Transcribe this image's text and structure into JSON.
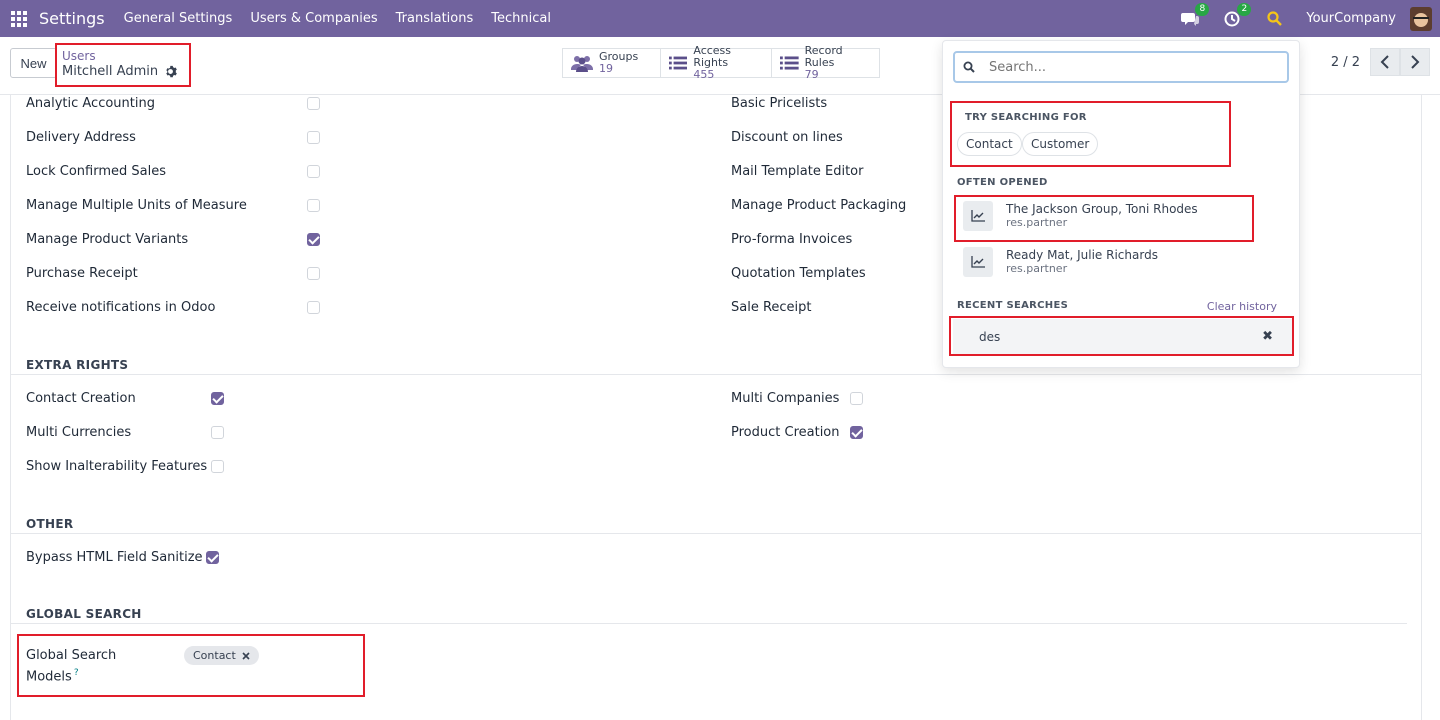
{
  "navbar": {
    "app_name": "Settings",
    "menu": [
      "General Settings",
      "Users & Companies",
      "Translations",
      "Technical"
    ],
    "messages_badge": "8",
    "activities_badge": "2",
    "company": "YourCompany",
    "accent": "#71639e"
  },
  "control": {
    "new_label": "New",
    "breadcrumb_parent": "Users",
    "breadcrumb_current": "Mitchell Admin",
    "stats": [
      {
        "label": "Groups",
        "value": "19",
        "icon": "users-icon"
      },
      {
        "label": "Access Rights",
        "value": "455",
        "icon": "list-icon"
      },
      {
        "label": "Record Rules",
        "value": "79",
        "icon": "list-icon"
      }
    ],
    "pager": "2 / 2"
  },
  "form": {
    "left_rows": [
      {
        "label": "Analytic Accounting",
        "checked": false
      },
      {
        "label": "Delivery Address",
        "checked": false
      },
      {
        "label": "Lock Confirmed Sales",
        "checked": false
      },
      {
        "label": "Manage Multiple Units of Measure",
        "checked": false
      },
      {
        "label": "Manage Product Variants",
        "checked": true
      },
      {
        "label": "Purchase Receipt",
        "checked": false
      },
      {
        "label": "Receive notifications in Odoo",
        "checked": false
      }
    ],
    "right_rows": [
      {
        "label": "Basic Pricelists"
      },
      {
        "label": "Discount on lines"
      },
      {
        "label": "Mail Template Editor"
      },
      {
        "label": "Manage Product Packaging"
      },
      {
        "label": "Pro-forma Invoices"
      },
      {
        "label": "Quotation Templates"
      },
      {
        "label": "Sale Receipt"
      }
    ],
    "extra_rights": {
      "title": "EXTRA RIGHTS",
      "left": [
        {
          "label": "Contact Creation",
          "checked": true
        },
        {
          "label": "Multi Currencies",
          "checked": false
        },
        {
          "label": "Show Inalterability Features",
          "checked": false
        }
      ],
      "right": [
        {
          "label": "Multi Companies",
          "checked": false
        },
        {
          "label": "Product Creation",
          "checked": true
        }
      ]
    },
    "other": {
      "title": "OTHER",
      "rows": [
        {
          "label": "Bypass HTML Field Sanitize",
          "checked": true
        }
      ]
    },
    "global_search": {
      "title": "GLOBAL SEARCH",
      "label_line1": "Global Search",
      "label_line2": "Models",
      "help": "?",
      "tag": "Contact"
    }
  },
  "dropdown": {
    "placeholder": "Search...",
    "try_heading": "TRY SEARCHING FOR",
    "suggestions": [
      "Contact",
      "Customer"
    ],
    "often_heading": "OFTEN OPENED",
    "often": [
      {
        "title": "The Jackson Group, Toni Rhodes",
        "model": "res.partner"
      },
      {
        "title": "Ready Mat, Julie Richards",
        "model": "res.partner"
      }
    ],
    "recent_heading": "RECENT SEARCHES",
    "clear_label": "Clear history",
    "recent": [
      "des"
    ]
  }
}
